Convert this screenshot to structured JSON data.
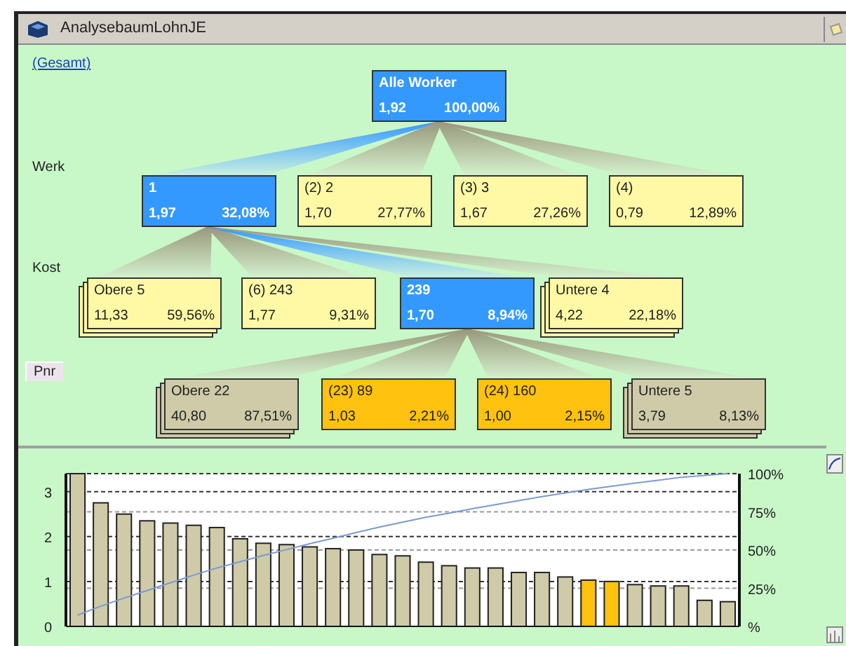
{
  "window": {
    "title": "AnalysebaumLohnJE"
  },
  "tree": {
    "link": "(Gesamt)",
    "levels": [
      {
        "label": "Werk",
        "kind": "label"
      },
      {
        "label": "Kost",
        "kind": "label"
      },
      {
        "label": "Pnr",
        "kind": "button"
      }
    ],
    "root": {
      "title": "Alle Worker",
      "value": "1,92",
      "share": "100,00%",
      "selected": true,
      "color": "#3399ff",
      "stacked": false,
      "children": [
        {
          "title": "1",
          "value": "1,97",
          "share": "32,08%",
          "selected": true,
          "color": "#3399ff",
          "stacked": false,
          "children": [
            {
              "title": "Obere 5",
              "value": "11,33",
              "share": "59,56%",
              "selected": false,
              "color": "#fff9a6",
              "stacked": true
            },
            {
              "title": "(6) 243",
              "value": "1,77",
              "share": "9,31%",
              "selected": false,
              "color": "#fff9a6",
              "stacked": false
            },
            {
              "title": "239",
              "value": "1,70",
              "share": "8,94%",
              "selected": true,
              "color": "#3399ff",
              "stacked": false,
              "children": [
                {
                  "title": "Obere 22",
                  "value": "40,80",
                  "share": "87,51%",
                  "selected": false,
                  "color": "#cfcba8",
                  "stacked": true
                },
                {
                  "title": "(23) 89",
                  "value": "1,03",
                  "share": "2,21%",
                  "selected": false,
                  "color": "#ffc20e",
                  "stacked": false
                },
                {
                  "title": "(24) 160",
                  "value": "1,00",
                  "share": "2,15%",
                  "selected": false,
                  "color": "#ffc20e",
                  "stacked": false
                },
                {
                  "title": "Untere 5",
                  "value": "3,79",
                  "share": "8,13%",
                  "selected": false,
                  "color": "#cfcba8",
                  "stacked": true
                }
              ]
            },
            {
              "title": "Untere 4",
              "value": "4,22",
              "share": "22,18%",
              "selected": false,
              "color": "#fff9a6",
              "stacked": true
            }
          ]
        },
        {
          "title": "(2) 2",
          "value": "1,70",
          "share": "27,77%",
          "selected": false,
          "color": "#fff9a6",
          "stacked": false
        },
        {
          "title": "(3) 3",
          "value": "1,67",
          "share": "27,26%",
          "selected": false,
          "color": "#fff9a6",
          "stacked": false
        },
        {
          "title": "(4)",
          "value": "0,79",
          "share": "12,89%",
          "selected": false,
          "color": "#fff9a6",
          "stacked": false
        }
      ]
    }
  },
  "chart": {
    "right_axis_labels": [
      "100%",
      "75%",
      "50%",
      "25%",
      "%"
    ],
    "chart_data": {
      "type": "bar",
      "stacked": true,
      "grid": true,
      "ylim": [
        0,
        3.4
      ],
      "yticks": [
        0,
        1,
        2,
        3
      ],
      "series": [
        {
          "color": "#cfcba8",
          "values": [
            3.4,
            2.75,
            2.5,
            2.35,
            2.3,
            2.25,
            2.2,
            1.95,
            1.85,
            1.82,
            1.77,
            1.73,
            1.7,
            1.6,
            1.57,
            1.43,
            1.35,
            1.3,
            1.3,
            1.2,
            1.2,
            1.1,
            null,
            null,
            0.93,
            0.9,
            0.9,
            0.58,
            0.55
          ]
        },
        {
          "color": "#ffc20e",
          "values": [
            null,
            null,
            null,
            null,
            null,
            null,
            null,
            null,
            null,
            null,
            null,
            null,
            null,
            null,
            null,
            null,
            null,
            null,
            null,
            null,
            null,
            null,
            1.03,
            1.0,
            null,
            null,
            null,
            null,
            null
          ]
        },
        {
          "type": "line",
          "color": "#7a9ad0",
          "values": [
            0.25,
            0.45,
            0.63,
            0.8,
            0.97,
            1.14,
            1.3,
            1.44,
            1.58,
            1.71,
            1.84,
            1.96,
            2.09,
            2.21,
            2.32,
            2.43,
            2.52,
            2.62,
            2.71,
            2.8,
            2.89,
            2.97,
            3.05,
            3.12,
            3.19,
            3.25,
            3.32,
            3.36,
            3.4
          ]
        }
      ]
    }
  }
}
